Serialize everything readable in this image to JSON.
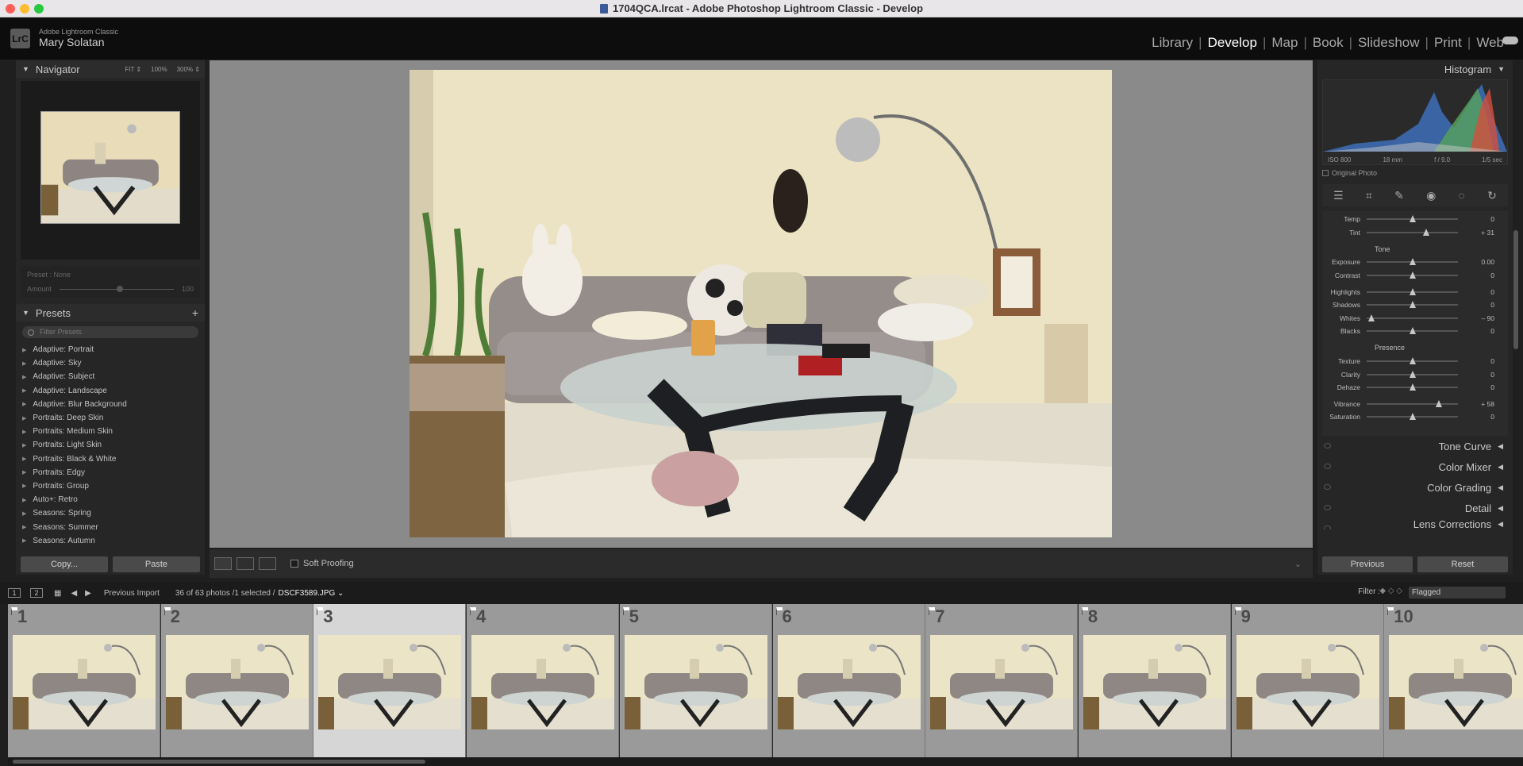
{
  "window": {
    "title": "1704QCA.lrcat - Adobe Photoshop Lightroom Classic - Develop"
  },
  "identity": {
    "logo": "LrC",
    "app_name": "Adobe Lightroom Classic",
    "user": "Mary Solatan"
  },
  "modules": [
    "Library",
    "Develop",
    "Map",
    "Book",
    "Slideshow",
    "Print",
    "Web"
  ],
  "active_module": "Develop",
  "navigator": {
    "title": "Navigator",
    "zoom_fit": "FIT ⇕",
    "zoom_100": "100%",
    "zoom_300": "300% ⇕"
  },
  "preset_info": {
    "preset": "Preset : None",
    "amount_label": "Amount",
    "amount_value": "100",
    "amount_fraction": 0.5
  },
  "presets": {
    "title": "Presets",
    "add": "+",
    "filter_placeholder": "Filter Presets",
    "items": [
      "Adaptive: Portrait",
      "Adaptive: Sky",
      "Adaptive: Subject",
      "Adaptive: Landscape",
      "Adaptive: Blur Background",
      "Portraits: Deep Skin",
      "Portraits: Medium Skin",
      "Portraits: Light Skin",
      "Portraits: Black & White",
      "Portraits: Edgy",
      "Portraits: Group",
      "Auto+: Retro",
      "Seasons: Spring",
      "Seasons: Summer",
      "Seasons: Autumn"
    ]
  },
  "left_buttons": {
    "copy": "Copy...",
    "paste": "Paste"
  },
  "toolbar": {
    "soft_proofing": "Soft Proofing"
  },
  "histogram": {
    "title": "Histogram",
    "iso": "ISO 800",
    "focal": "18 mm",
    "aperture": "f / 9.0",
    "shutter": "1/5 sec",
    "original_photo": "Original Photo"
  },
  "basic": {
    "sliders_top": [
      {
        "label": "Temp",
        "value": "0",
        "pos": 0.5
      },
      {
        "label": "Tint",
        "value": "+ 31",
        "pos": 0.65
      }
    ],
    "tone_label": "Tone",
    "tone": [
      {
        "label": "Exposure",
        "value": "0.00",
        "pos": 0.5
      },
      {
        "label": "Contrast",
        "value": "0",
        "pos": 0.5
      }
    ],
    "tone2": [
      {
        "label": "Highlights",
        "value": "0",
        "pos": 0.5
      },
      {
        "label": "Shadows",
        "value": "0",
        "pos": 0.5
      },
      {
        "label": "Whites",
        "value": "– 90",
        "pos": 0.05
      },
      {
        "label": "Blacks",
        "value": "0",
        "pos": 0.5
      }
    ],
    "presence_label": "Presence",
    "presence": [
      {
        "label": "Texture",
        "value": "0",
        "pos": 0.5
      },
      {
        "label": "Clarity",
        "value": "0",
        "pos": 0.5
      },
      {
        "label": "Dehaze",
        "value": "0",
        "pos": 0.5
      }
    ],
    "presence2": [
      {
        "label": "Vibrance",
        "value": "+ 58",
        "pos": 0.79
      },
      {
        "label": "Saturation",
        "value": "0",
        "pos": 0.5
      }
    ]
  },
  "collapsed_panels": [
    "Tone Curve",
    "Color Mixer",
    "Color Grading",
    "Detail",
    "Lens Corrections"
  ],
  "right_buttons": {
    "previous": "Previous",
    "reset": "Reset"
  },
  "filmstrip_bar": {
    "monitor1": "1",
    "monitor2": "2",
    "source": "Previous Import",
    "count": "36 of 63 photos /1 selected /",
    "filename": "DSCF3589.JPG ⌄",
    "filter_label": "Filter :",
    "filter_value": "Flagged"
  },
  "filmstrip": [
    "1",
    "2",
    "3",
    "4",
    "5",
    "6",
    "7",
    "8",
    "9",
    "10"
  ],
  "selected_index": 2
}
